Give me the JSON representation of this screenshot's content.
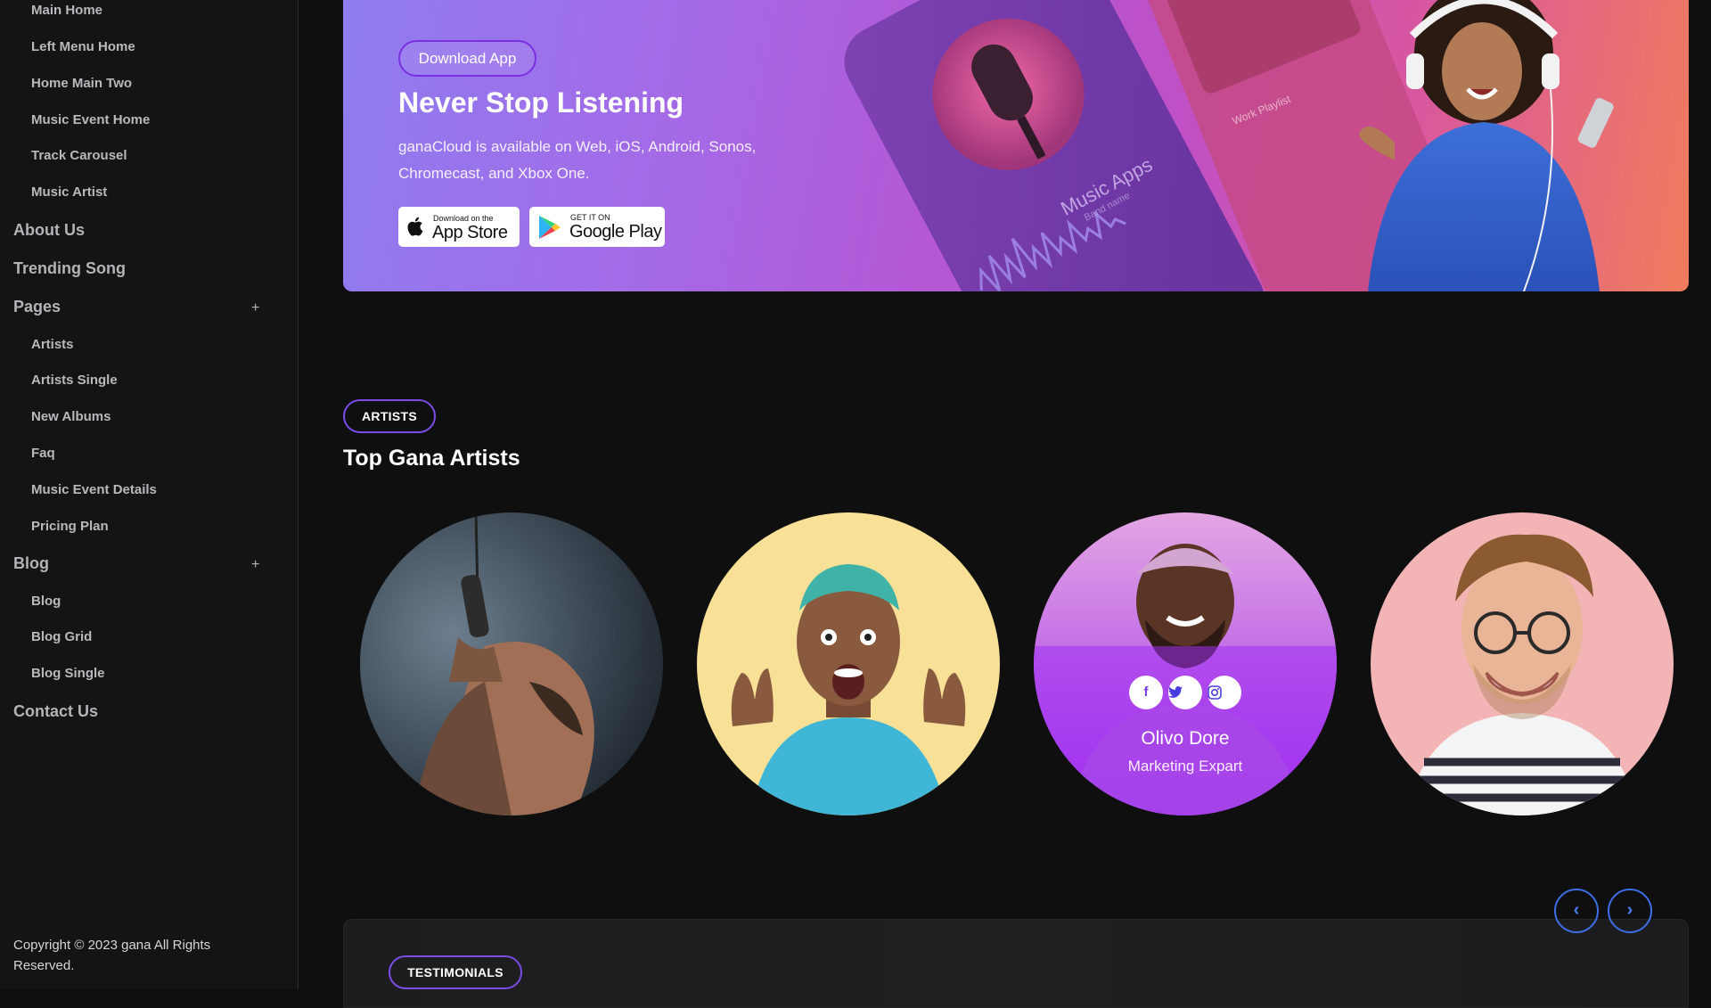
{
  "sidebar": {
    "sub_items_top": [
      {
        "label": "Main Home"
      },
      {
        "label": "Left Menu Home"
      },
      {
        "label": "Home Main Two"
      },
      {
        "label": "Music Event Home"
      },
      {
        "label": "Track Carousel"
      },
      {
        "label": "Music Artist"
      }
    ],
    "about_us": "About Us",
    "trending_song": "Trending Song",
    "pages": {
      "label": "Pages",
      "toggle": "+",
      "items": [
        {
          "label": "Artists"
        },
        {
          "label": "Artists Single"
        },
        {
          "label": "New Albums"
        },
        {
          "label": "Faq"
        },
        {
          "label": "Music Event Details"
        },
        {
          "label": "Pricing Plan"
        }
      ]
    },
    "blog": {
      "label": "Blog",
      "toggle": "+",
      "items": [
        {
          "label": "Blog"
        },
        {
          "label": "Blog Grid"
        },
        {
          "label": "Blog Single"
        }
      ]
    },
    "contact_us": "Contact Us",
    "copyright": "Copyright © 2023 gana All Rights Reserved."
  },
  "hero": {
    "button_label": "Download App",
    "title": "Never Stop Listening",
    "description": "ganaCloud is available on Web, iOS, Android, Sonos, Chromecast, and Xbox One.",
    "phone_text": "Music Apps",
    "phone_subtext": "Band name",
    "playlist_text": "Work Playlist",
    "appstore": {
      "small": "Download on the",
      "big": "App Store"
    },
    "googleplay": {
      "small": "GET IT ON",
      "big": "Google Play"
    }
  },
  "artists": {
    "badge": "ARTISTS",
    "title": "Top Gana Artists",
    "featured": {
      "name": "Olivo Dore",
      "role": "Marketing Expart",
      "socials": [
        "facebook-icon",
        "twitter-icon",
        "instagram-icon"
      ]
    }
  },
  "testimonials": {
    "badge": "TESTIMONIALS",
    "prev": "‹",
    "next": "›"
  },
  "colors": {
    "accent": "#7b4ce8",
    "arrow": "#3e6ee6",
    "background": "#0f0f10"
  }
}
